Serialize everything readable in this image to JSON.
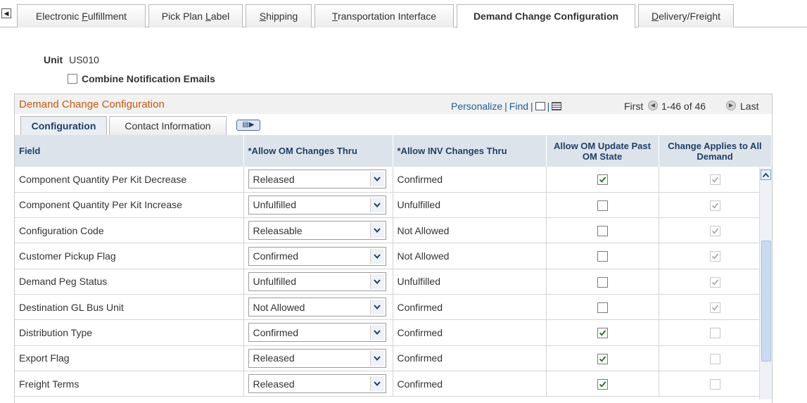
{
  "tabs": [
    {
      "label": "Electronic Fulfillment",
      "underline": "F"
    },
    {
      "label": "Pick Plan Label",
      "underline": "L"
    },
    {
      "label": "Shipping",
      "underline": "S"
    },
    {
      "label": "Transportation Interface",
      "underline": "T"
    },
    {
      "label": "Demand Change Configuration",
      "active": true
    },
    {
      "label": "Delivery/Freight",
      "underline": "D"
    }
  ],
  "unit": {
    "label": "Unit",
    "value": "US010"
  },
  "combine": {
    "label": "Combine Notification Emails",
    "checked": false
  },
  "grid": {
    "title": "Demand Change Configuration",
    "personalize": "Personalize",
    "find": "Find",
    "first": "First",
    "range": "1-46 of 46",
    "last": "Last",
    "subtabs": [
      "Configuration",
      "Contact Information"
    ],
    "columns": [
      "Field",
      "*Allow OM Changes Thru",
      "*Allow INV Changes Thru",
      "Allow OM Update Past OM State",
      "Change Applies to All Demand"
    ],
    "rows": [
      {
        "field": "Component Quantity Per Kit Decrease",
        "om": "Released",
        "inv": "Confirmed",
        "om_update": true,
        "applies_all": true
      },
      {
        "field": "Component Quantity Per Kit Increase",
        "om": "Unfulfilled",
        "inv": "Unfulfilled",
        "om_update": false,
        "applies_all": true
      },
      {
        "field": "Configuration Code",
        "om": "Releasable",
        "inv": "Not Allowed",
        "om_update": false,
        "applies_all": true
      },
      {
        "field": "Customer Pickup Flag",
        "om": "Confirmed",
        "inv": "Not Allowed",
        "om_update": false,
        "applies_all": true
      },
      {
        "field": "Demand Peg Status",
        "om": "Unfulfilled",
        "inv": "Unfulfilled",
        "om_update": false,
        "applies_all": true
      },
      {
        "field": "Destination GL Bus Unit",
        "om": "Not Allowed",
        "inv": "Confirmed",
        "om_update": false,
        "applies_all": true
      },
      {
        "field": "Distribution Type",
        "om": "Confirmed",
        "inv": "Confirmed",
        "om_update": true,
        "applies_all": false
      },
      {
        "field": "Export Flag",
        "om": "Released",
        "inv": "Confirmed",
        "om_update": true,
        "applies_all": false
      },
      {
        "field": "Freight Terms",
        "om": "Released",
        "inv": "Confirmed",
        "om_update": true,
        "applies_all": false
      }
    ]
  },
  "colors": {
    "title": "#c55a11",
    "link": "#1f5c99",
    "header_bg": "#dde3eb",
    "header_text": "#1f3f66"
  }
}
